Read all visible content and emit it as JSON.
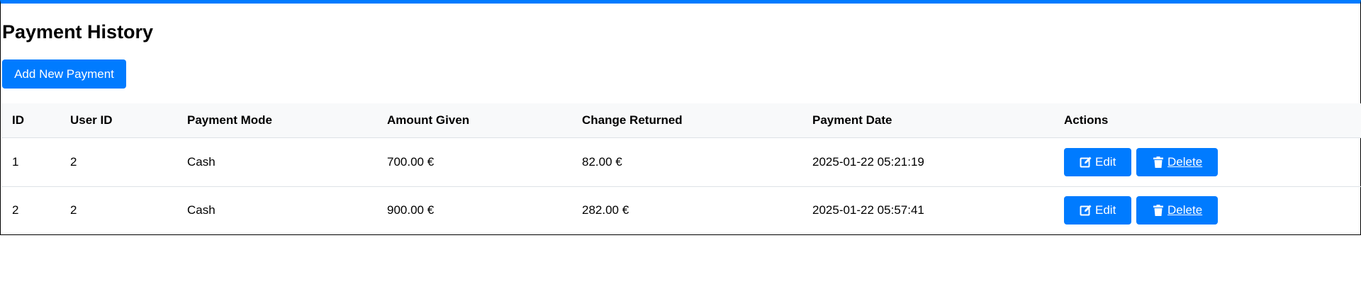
{
  "page": {
    "title": "Payment History",
    "add_button_label": "Add New Payment",
    "accent_color": "#007bff"
  },
  "table": {
    "headers": {
      "id": "ID",
      "user_id": "User ID",
      "payment_mode": "Payment Mode",
      "amount_given": "Amount Given",
      "change_returned": "Change Returned",
      "payment_date": "Payment Date",
      "actions": "Actions"
    },
    "rows": [
      {
        "id": "1",
        "user_id": "2",
        "payment_mode": "Cash",
        "amount_given": "700.00 €",
        "change_returned": "82.00 €",
        "payment_date": "2025-01-22 05:21:19",
        "edit_label": "Edit",
        "delete_label": "Delete"
      },
      {
        "id": "2",
        "user_id": "2",
        "payment_mode": "Cash",
        "amount_given": "900.00 €",
        "change_returned": "282.00 €",
        "payment_date": "2025-01-22 05:57:41",
        "edit_label": "Edit",
        "delete_label": "Delete"
      }
    ]
  },
  "icons": {
    "edit": "edit-icon",
    "delete": "trash-icon"
  }
}
